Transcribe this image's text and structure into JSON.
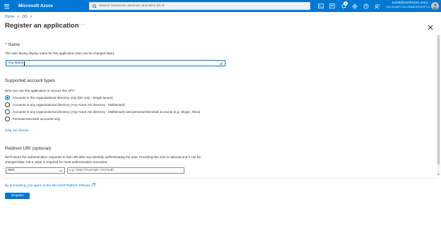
{
  "topbar": {
    "brand": "Microsoft Azure",
    "search_placeholder": "Search resources, services, and docs (G+/)",
    "notification_count": "4",
    "account_user": "sumit@sumit1231.onmi...",
    "account_directory": "DD (SUMIT1231.ONMICROSOFT.C..."
  },
  "breadcrumb": {
    "home": "Home",
    "dd": "DD",
    "separator": ">"
  },
  "page": {
    "title": "Register an application",
    "more": "···"
  },
  "name_section": {
    "required_mark": "*",
    "label": "Name",
    "help": "The user-facing display name for this application (this can be changed later).",
    "value": "Any Name"
  },
  "account_types": {
    "title": "Supported account types",
    "question": "Who can use this application or access this API?",
    "options": [
      {
        "label": "Accounts in this organizational directory only (DD only - Single tenant)",
        "checked": true
      },
      {
        "label": "Accounts in any organizational directory (Any Azure AD directory - Multitenant)",
        "checked": false
      },
      {
        "label": "Accounts in any organizational directory (Any Azure AD directory - Multitenant) and personal Microsoft accounts (e.g. Skype, Xbox)",
        "checked": false
      },
      {
        "label": "Personal Microsoft accounts only",
        "checked": false
      }
    ],
    "help_link": "Help me choose..."
  },
  "redirect": {
    "title": "Redirect URI (optional)",
    "help_line1": "We'll return the authentication response to this URI after successfully authenticating the user. Providing this now is optional and it can be",
    "help_line2": "changed later, but a value is required for most authentication scenarios.",
    "platform": "Web",
    "uri_placeholder": "e.g. https://example.com/auth"
  },
  "footer": {
    "policy": "By proceeding, you agree to the Microsoft Platform Policies",
    "register": "Register"
  },
  "colors": {
    "azure_blue": "#0078d4",
    "required_red": "#a4262c"
  },
  "icons": [
    "hamburger-icon",
    "search-icon",
    "cloud-shell-icon",
    "directory-filter-icon",
    "bell-icon",
    "gear-icon",
    "help-icon",
    "feedback-icon",
    "close-icon",
    "chevron-down-icon",
    "check-icon",
    "external-link-icon"
  ]
}
